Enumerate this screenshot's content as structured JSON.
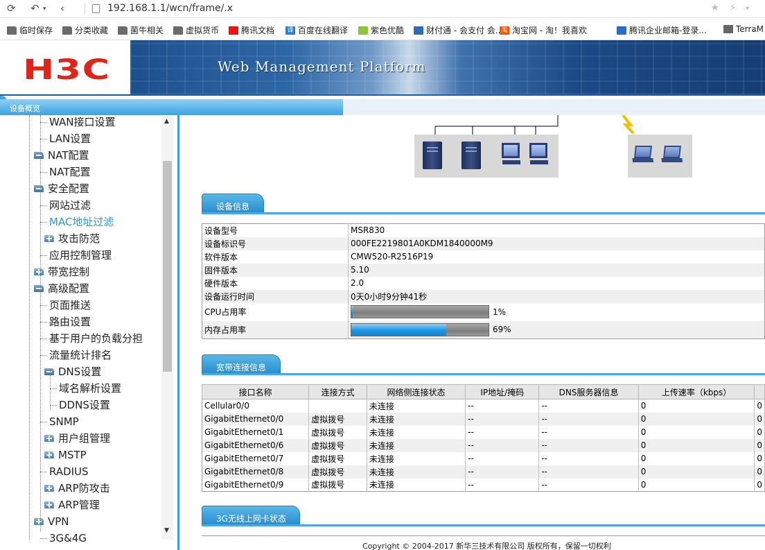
{
  "browser": {
    "url": "192.168.1.1/wcn/frame/.x",
    "bookmarks": [
      {
        "label": "临时保存",
        "icon": "folder-icon"
      },
      {
        "label": "分类收藏",
        "icon": "folder-icon"
      },
      {
        "label": "菌牛相关",
        "icon": "folder-icon"
      },
      {
        "label": "虚拟货币",
        "icon": "folder-icon"
      },
      {
        "label": "腾讯文档",
        "icon": "tencent-docs-icon",
        "color": "#e8140f"
      },
      {
        "label": "百度在线翻译",
        "icon": "translate-icon",
        "color": "#2a7de1",
        "glyph": "译"
      },
      {
        "label": "紫色优酷",
        "icon": "youku-icon",
        "color": "#8cc63f"
      },
      {
        "label": "财付通 - 会支付 会...",
        "icon": "tenpay-shield-icon",
        "color": "#2d6db5"
      },
      {
        "label": "淘宝网 - 淘！我喜欢",
        "icon": "taobao-icon",
        "color": "#ff5000",
        "glyph": "淘"
      },
      {
        "label": "腾讯企业邮箱-登录...",
        "icon": "exmail-icon",
        "color": "#2a6cc8"
      },
      {
        "label": "TerraM",
        "icon": "page-icon",
        "color": "#666666"
      }
    ]
  },
  "header": {
    "logo": "H3C",
    "platform_title": "Web Management Platform",
    "active_tab": "设备概览"
  },
  "sidebar": {
    "items": [
      {
        "label": "WAN接口设置",
        "level": 2,
        "type": "leaf"
      },
      {
        "label": "LAN设置",
        "level": 2,
        "type": "leaf"
      },
      {
        "label": "NAT配置",
        "level": 1,
        "type": "open"
      },
      {
        "label": "NAT配置",
        "level": 2,
        "type": "leaf"
      },
      {
        "label": "安全配置",
        "level": 1,
        "type": "open"
      },
      {
        "label": "网站过滤",
        "level": 2,
        "type": "leaf"
      },
      {
        "label": "MAC地址过滤",
        "level": 2,
        "type": "leaf",
        "selected": true
      },
      {
        "label": "攻击防范",
        "level": 2,
        "type": "closed"
      },
      {
        "label": "应用控制管理",
        "level": 2,
        "type": "leaf"
      },
      {
        "label": "带宽控制",
        "level": 1,
        "type": "closed"
      },
      {
        "label": "高级配置",
        "level": 1,
        "type": "open"
      },
      {
        "label": "页面推送",
        "level": 2,
        "type": "leaf"
      },
      {
        "label": "路由设置",
        "level": 2,
        "type": "leaf"
      },
      {
        "label": "基于用户的负载分担",
        "level": 2,
        "type": "leaf"
      },
      {
        "label": "流量统计排名",
        "level": 2,
        "type": "leaf"
      },
      {
        "label": "DNS设置",
        "level": 2,
        "type": "open"
      },
      {
        "label": "域名解析设置",
        "level": 3,
        "type": "leaf"
      },
      {
        "label": "DDNS设置",
        "level": 3,
        "type": "leaf"
      },
      {
        "label": "SNMP",
        "level": 2,
        "type": "leaf"
      },
      {
        "label": "用户组管理",
        "level": 2,
        "type": "closed"
      },
      {
        "label": "MSTP",
        "level": 2,
        "type": "closed"
      },
      {
        "label": "RADIUS",
        "level": 2,
        "type": "leaf"
      },
      {
        "label": "ARP防攻击",
        "level": 2,
        "type": "closed"
      },
      {
        "label": "ARP管理",
        "level": 2,
        "type": "closed"
      },
      {
        "label": "VPN",
        "level": 1,
        "type": "closed"
      },
      {
        "label": "3G&4G",
        "level": 2,
        "type": "leaf"
      }
    ]
  },
  "device_info": {
    "section_title": "设备信息",
    "rows": [
      {
        "key": "设备型号",
        "value": "MSR830"
      },
      {
        "key": "设备标识号",
        "value": "000FE2219801A0KDM1840000M9"
      },
      {
        "key": "软件版本",
        "value": "CMW520-R2516P19"
      },
      {
        "key": "固件版本",
        "value": "5.10"
      },
      {
        "key": "硬件版本",
        "value": "2.0"
      },
      {
        "key": "设备运行时间",
        "value": "0天0小时9分钟41秒"
      }
    ],
    "cpu": {
      "label": "CPU占用率",
      "percent": 1,
      "text": "1%"
    },
    "memory": {
      "label": "内存占用率",
      "percent": 69,
      "text": "69%"
    }
  },
  "wan": {
    "section_title": "宽带连接信息",
    "headers": [
      "接口名称",
      "连接方式",
      "网络侧连接状态",
      "IP地址/掩码",
      "DNS服务器信息",
      "上传速率（kbps）",
      ""
    ],
    "rows": [
      [
        "Cellular0/0",
        "",
        "未连接",
        "--",
        "--",
        "0",
        "0"
      ],
      [
        "GigabitEthernet0/0",
        "虚拟拨号",
        "未连接",
        "--",
        "--",
        "0",
        "0"
      ],
      [
        "GigabitEthernet0/1",
        "虚拟拨号",
        "未连接",
        "--",
        "--",
        "0",
        "0"
      ],
      [
        "GigabitEthernet0/6",
        "虚拟拨号",
        "未连接",
        "--",
        "--",
        "0",
        "0"
      ],
      [
        "GigabitEthernet0/7",
        "虚拟拨号",
        "未连接",
        "--",
        "--",
        "0",
        "0"
      ],
      [
        "GigabitEthernet0/8",
        "虚拟拨号",
        "未连接",
        "--",
        "--",
        "0",
        "0"
      ],
      [
        "GigabitEthernet0/9",
        "虚拟拨号",
        "未连接",
        "--",
        "--",
        "0",
        "0"
      ]
    ]
  },
  "g3": {
    "section_title": "3G无线上网卡状态"
  },
  "footer": {
    "copyright": "Copyright © 2004-2017 新华三技术有限公司 版权所有，保留一切权利"
  },
  "colors": {
    "accent": "#3aa4e3",
    "brand": "#e2231a",
    "selected_menu": "#2b9be0"
  }
}
